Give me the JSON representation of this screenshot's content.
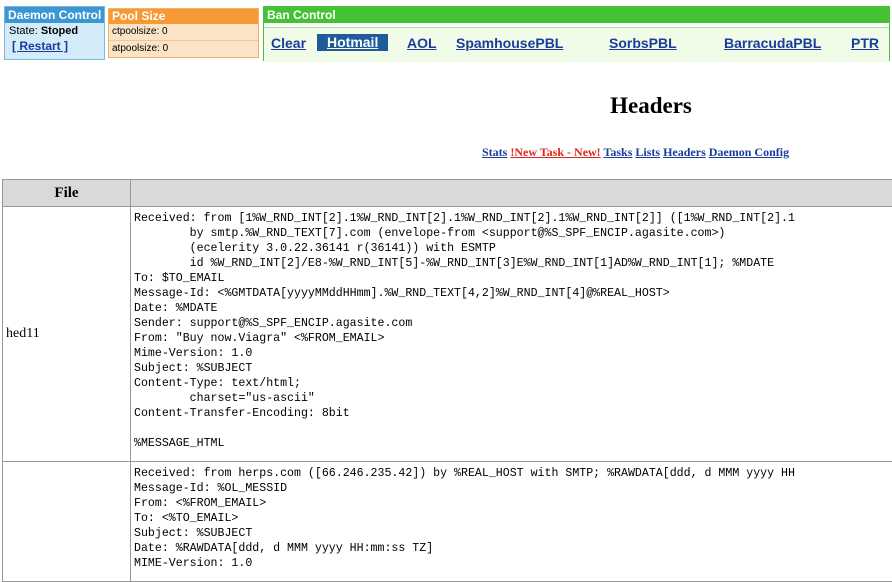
{
  "daemon_control": {
    "title": "Daemon Control",
    "state_label": "State:",
    "state_value": "Stoped",
    "restart_label": "[ Restart ]"
  },
  "pool_size": {
    "title": "Pool Size",
    "ctpoolsize": "ctpoolsize: 0",
    "atpoolsize": "atpoolsize: 0"
  },
  "ban_control": {
    "title": "Ban Control",
    "links": [
      "Clear",
      "Hotmail",
      "AOL",
      "SpamhousePBL",
      "SorbsPBL",
      "BarracudaPBL",
      "PTR"
    ],
    "active": "Hotmail"
  },
  "page_title": "Headers",
  "nav": {
    "stats": "Stats",
    "new_task": "!New Task - New!",
    "tasks": "Tasks",
    "lists": "Lists",
    "headers": "Headers",
    "daemon_config": "Daemon Config"
  },
  "table": {
    "columns": [
      "File",
      ""
    ],
    "rows": [
      {
        "file": "hed11",
        "header": "Received: from [1%W_RND_INT[2].1%W_RND_INT[2].1%W_RND_INT[2].1%W_RND_INT[2]] ([1%W_RND_INT[2].1\n        by smtp.%W_RND_TEXT[7].com (envelope-from <support@%S_SPF_ENCIP.agasite.com>)\n        (ecelerity 3.0.22.36141 r(36141)) with ESMTP\n        id %W_RND_INT[2]/E8-%W_RND_INT[5]-%W_RND_INT[3]E%W_RND_INT[1]AD%W_RND_INT[1]; %MDATE\nTo: $TO_EMAIL\nMessage-Id: <%GMTDATA[yyyyMMddHHmm].%W_RND_TEXT[4,2]%W_RND_INT[4]@%REAL_HOST>\nDate: %MDATE\nSender: support@%S_SPF_ENCIP.agasite.com\nFrom: \"Buy now.Viagra\" <%FROM_EMAIL>\nMime-Version: 1.0\nSubject: %SUBJECT\nContent-Type: text/html;\n        charset=\"us-ascii\"\nContent-Transfer-Encoding: 8bit\n\n%MESSAGE_HTML"
      },
      {
        "file": "",
        "header": "Received: from herps.com ([66.246.235.42]) by %REAL_HOST with SMTP; %RAWDATA[ddd, d MMM yyyy HH\nMessage-Id: %OL_MESSID\nFrom: <%FROM_EMAIL>\nTo: <%TO_EMAIL>\nSubject: %SUBJECT\nDate: %RAWDATA[ddd, d MMM yyyy HH:mm:ss TZ]\nMIME-Version: 1.0"
      }
    ]
  },
  "colors": {
    "daemon_header": "#3a97d4",
    "pool_header": "#f59a34",
    "ban_header": "#44c233",
    "link": "#1a3d9c",
    "new_task": "#e0261a",
    "active_link_bg": "#1f5a9a"
  }
}
